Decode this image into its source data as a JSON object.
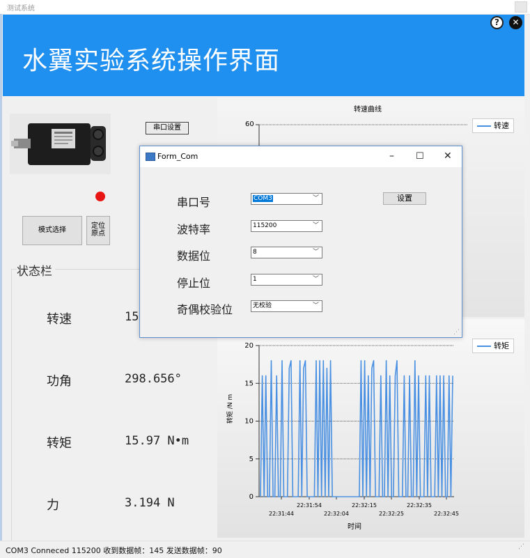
{
  "window": {
    "title": "测试系统"
  },
  "header": {
    "title": "水翼实验系统操作界面",
    "help_icon": "?",
    "close_icon": "✕"
  },
  "left": {
    "serial_button": "串口设置",
    "mode_button": "模式选择",
    "home_button_line1": "定位",
    "home_button_line2": "原点",
    "status_title": "状态栏",
    "status": [
      {
        "label": "转速",
        "value": "15"
      },
      {
        "label": "功角",
        "value": "298.656°"
      },
      {
        "label": "转矩",
        "value": "15.97 N•m"
      },
      {
        "label": "力",
        "value": "3.194 N"
      }
    ],
    "indicator_color": "#e81515"
  },
  "chart1_view": {
    "title": "转速曲线",
    "legend": "转速",
    "y_top_tick": "60"
  },
  "chart2_view": {
    "legend": "转矩",
    "ylabel": "转矩 /N m",
    "xlabel": "时间"
  },
  "dialog": {
    "title": "Form_Com",
    "min_icon": "–",
    "max_icon": "☐",
    "close_icon": "✕",
    "set_button": "设置",
    "fields": [
      {
        "label": "串口号",
        "value": "COM3"
      },
      {
        "label": "波特率",
        "value": "115200"
      },
      {
        "label": "数据位",
        "value": "8"
      },
      {
        "label": "停止位",
        "value": "1"
      },
      {
        "label": "奇偶校验位",
        "value": "无校验"
      }
    ]
  },
  "statusbar": {
    "text": "COM3 Conneced 115200  收到数据帧：145  发送数据帧：90"
  },
  "chart_data": [
    {
      "type": "line",
      "title": "转速曲线",
      "series": [
        {
          "name": "转速",
          "values": []
        }
      ],
      "ylim": [
        0,
        60
      ],
      "y_ticks": [
        "60"
      ],
      "legend": "top-right",
      "grid": true
    },
    {
      "type": "line",
      "title": "",
      "xlabel": "时间",
      "ylabel": "转矩 /N m",
      "ylim": [
        0,
        20
      ],
      "y_ticks": [
        "0",
        "5",
        "10",
        "15",
        "20"
      ],
      "x_ticks_upper": [
        "22:31:54",
        "22:32:15",
        "22:32:35"
      ],
      "x_ticks_lower": [
        "22:31:44",
        "22:32:04",
        "22:32:25",
        "22:32:45"
      ],
      "legend": "top-right",
      "grid": true,
      "series": [
        {
          "name": "转矩",
          "values": [
            0,
            16,
            0,
            16,
            0,
            0,
            18,
            0,
            0,
            16,
            0,
            0,
            18,
            0,
            0,
            0,
            17,
            18,
            0,
            0,
            0,
            0,
            18,
            0,
            17,
            18,
            0,
            0,
            0,
            0,
            0,
            18,
            0,
            18,
            0,
            18,
            0,
            17,
            0,
            18,
            0,
            0,
            0,
            0,
            0,
            0,
            0,
            0,
            0,
            0,
            0,
            0,
            0,
            0,
            0,
            0,
            18,
            0,
            18,
            0,
            16,
            0,
            17,
            18,
            0,
            0,
            0,
            16,
            0,
            0,
            18,
            0,
            16,
            0,
            0,
            16,
            18,
            0,
            0,
            0,
            16,
            0,
            0,
            16,
            0,
            0,
            18,
            0,
            16,
            0,
            0,
            0,
            16,
            0,
            16,
            0,
            0,
            0,
            16,
            0,
            16,
            0,
            16,
            0,
            0,
            16,
            0,
            16
          ]
        }
      ]
    }
  ]
}
